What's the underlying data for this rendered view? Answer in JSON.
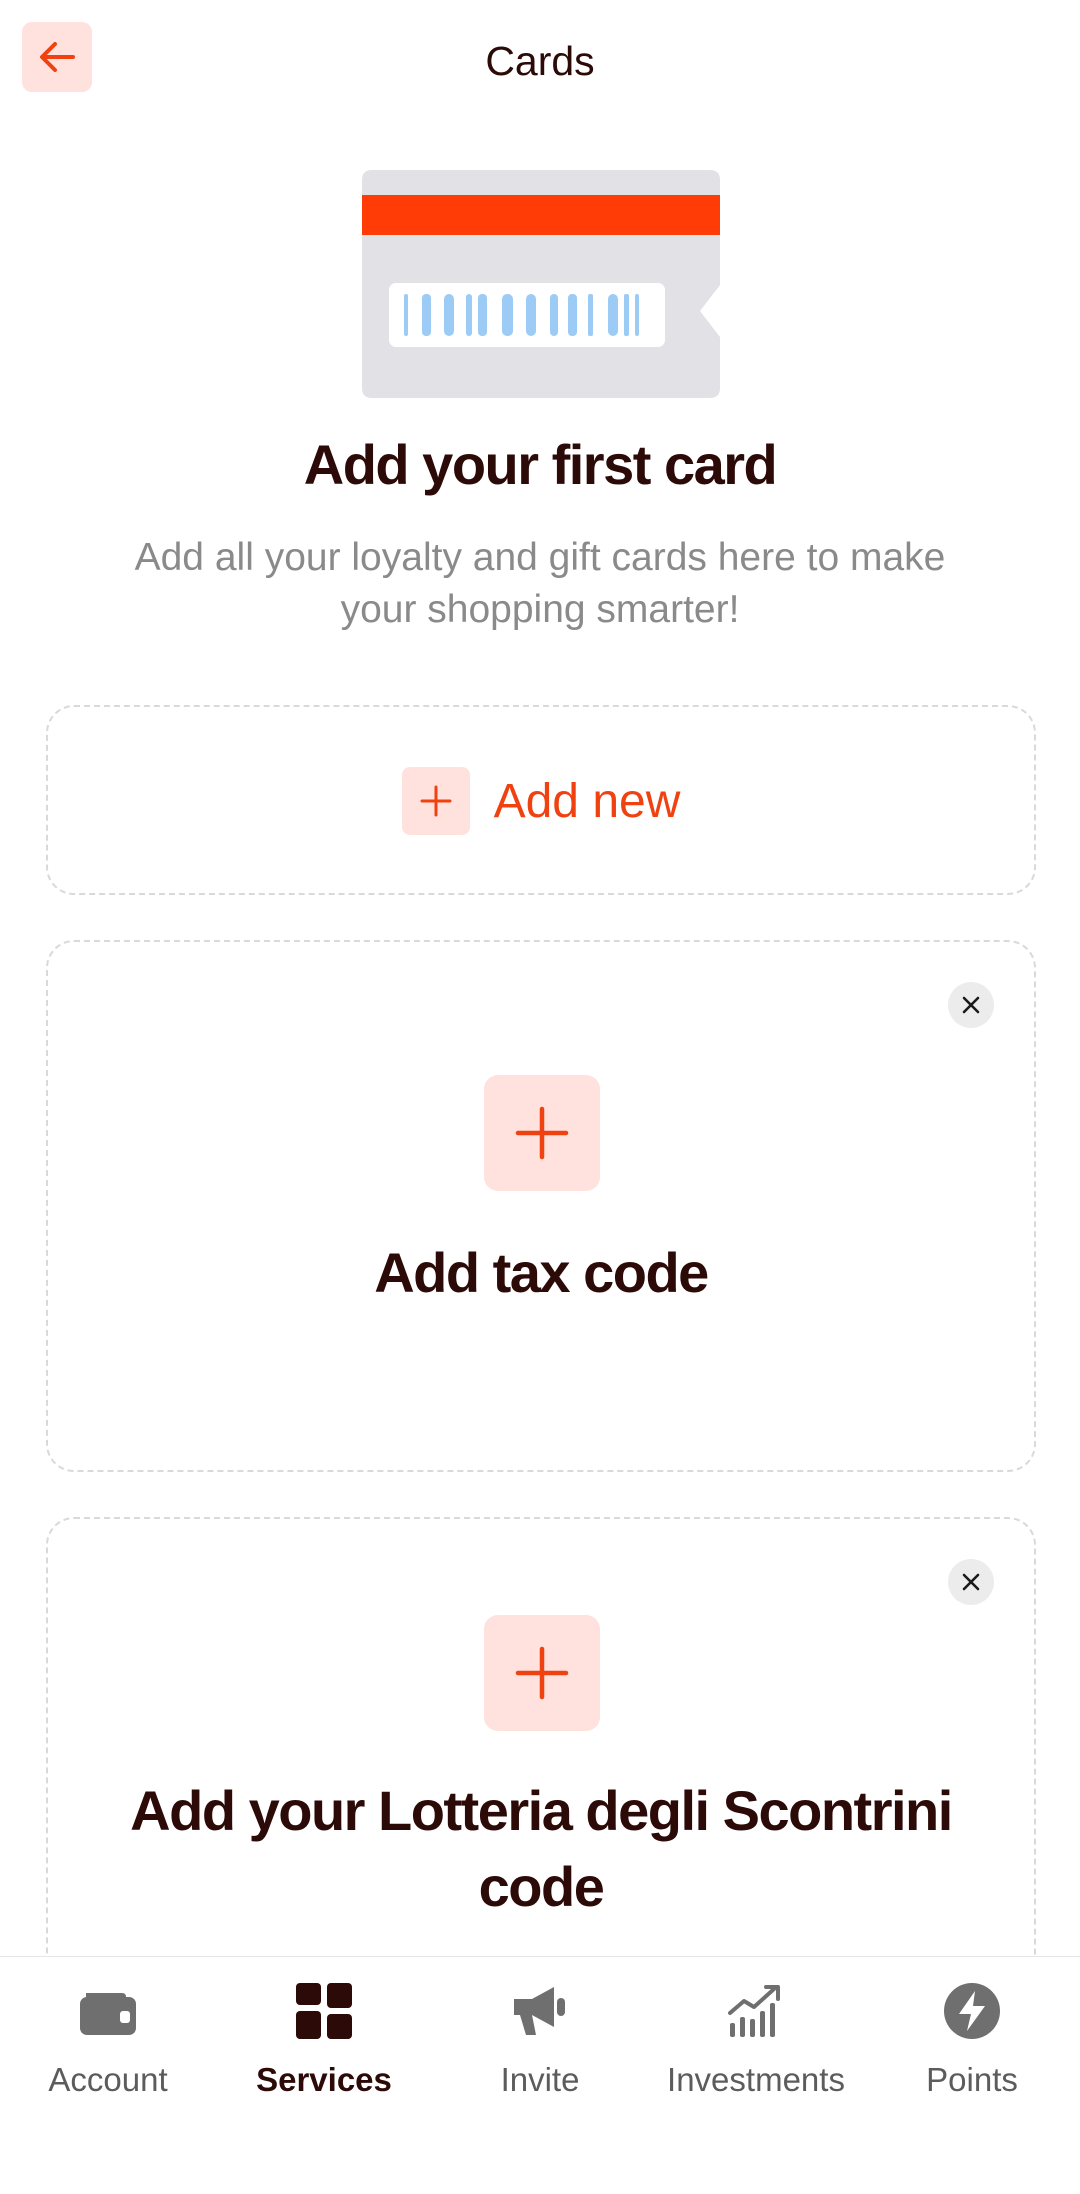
{
  "header": {
    "title": "Cards",
    "back_icon": "arrow-left-icon",
    "accent_color": "#f04210"
  },
  "hero": {
    "illustration": "loyalty-card-illustration",
    "title": "Add your first card",
    "description": "Add all your loyalty and gift cards here to make your shopping smarter!"
  },
  "add_new": {
    "label": "Add new",
    "icon": "plus-icon"
  },
  "tax_card": {
    "title": "Add tax code",
    "icon": "plus-icon",
    "close_icon": "close-icon"
  },
  "lottery_card": {
    "title": "Add your Lotteria degli Scontrini code",
    "icon": "plus-icon",
    "close_icon": "close-icon"
  },
  "bottom_nav": {
    "items": [
      {
        "label": "Account",
        "icon": "wallet-icon",
        "active": false
      },
      {
        "label": "Services",
        "icon": "grid-icon",
        "active": true
      },
      {
        "label": "Invite",
        "icon": "megaphone-icon",
        "active": false
      },
      {
        "label": "Investments",
        "icon": "chart-icon",
        "active": false
      },
      {
        "label": "Points",
        "icon": "bolt-icon",
        "active": false
      }
    ]
  },
  "colors": {
    "accent": "#f04210",
    "accent_light": "#ffe1de",
    "text_dark": "#2b0a07",
    "text_muted": "#8a8a8a",
    "nav_icon": "#6f6f6f"
  }
}
